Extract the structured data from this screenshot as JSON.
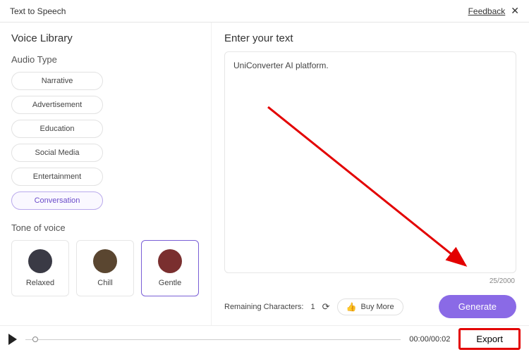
{
  "header": {
    "title": "Text to Speech",
    "feedback": "Feedback"
  },
  "sidebar": {
    "voice_library": "Voice Library",
    "audio_type_label": "Audio Type",
    "audio_types": [
      "Narrative",
      "Advertisement",
      "Education",
      "Social Media",
      "Entertainment",
      "Conversation"
    ],
    "tone_label": "Tone of voice",
    "tones": [
      "Relaxed",
      "Chill",
      "Gentle"
    ]
  },
  "panel": {
    "enter_text": "Enter your text",
    "textarea_value": "UniConverter AI platform.",
    "char_counter": "25/2000",
    "remaining_label": "Remaining Characters:",
    "remaining_count": "1",
    "buy_more": "Buy More",
    "generate": "Generate"
  },
  "player": {
    "time": "00:00/00:02",
    "export": "Export"
  }
}
